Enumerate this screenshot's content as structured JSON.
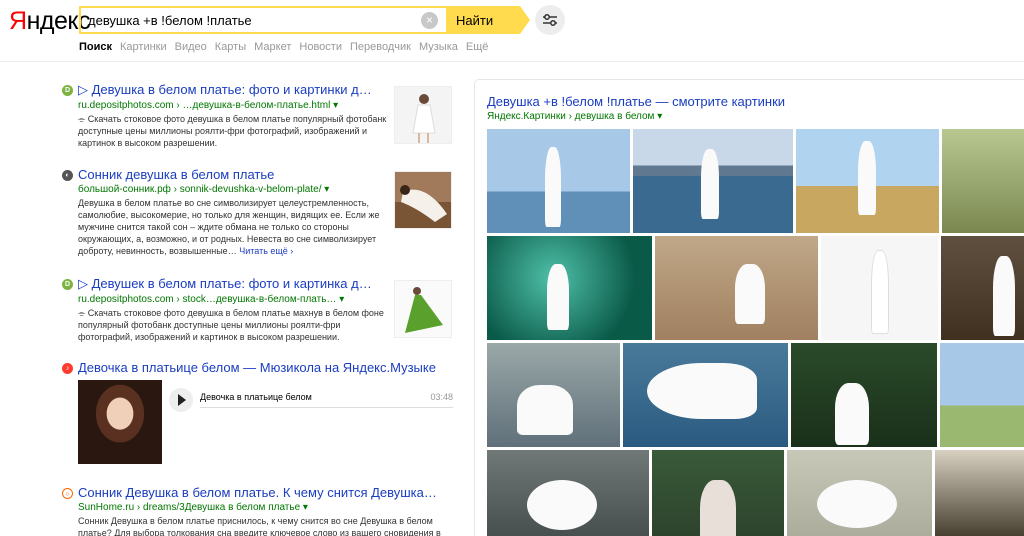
{
  "header": {
    "logo": "Яндекс",
    "query": "девушка +в !белом !платье",
    "find_label": "Найти"
  },
  "tabs": [
    "Поиск",
    "Картинки",
    "Видео",
    "Карты",
    "Маркет",
    "Новости",
    "Переводчик",
    "Музыка",
    "Ещё"
  ],
  "results": [
    {
      "title": "▷ Девушка в белом платье: фото и картинки д…",
      "url": "ru.depositphotos.com › …девушка-в-белом-платье.html ▾",
      "snippet": "⌯ Скачать стоковое фото девушка в белом платье популярный фотобанк доступные цены миллионы роялти-фри фотографий, изображений и картинок в высоком разрешении."
    },
    {
      "title": "Сонник девушка в белом платье",
      "url": "большой-сонник.рф › sonnik-devushka-v-belom-plate/ ▾",
      "snippet": "Девушка в белом платье во сне символизирует целеустремленность, самолюбие, высокомерие, но только для женщин, видящих ее. Если же мужчине снится такой сон – ждите обмана не только со стороны окружающих, а, возможно, и от родных. Невеста во сне символизирует доброту, невинность, возвышенные…",
      "more": "Читать ещё ›"
    },
    {
      "title": "▷ Девушек в белом платье: фото и картинка д…",
      "url": "ru.depositphotos.com › stock…девушка-в-белом-плать… ▾",
      "snippet": "⌯ Скачать стоковое фото девушка в белом платье махнув в белом фоне популярный фотобанк доступные цены миллионы роялти-фри фотографий, изображений и картинок в высоком разрешении."
    },
    {
      "title": "Девочка в платьице белом — Мюзикола на Яндекс.Музыке",
      "track": "Девочка в платьице белом",
      "duration": "03:48"
    },
    {
      "title": "Сонник Девушка в белом платье. К чему снится Девушка…",
      "url": "SunHome.ru › dreams/3Девушка в белом платье ▾",
      "snippet": "Сонник Девушка в белом платье приснилось, к чему снится во сне Девушка в белом платье? Для выбора толкования сна введите ключевое слово из вашего сновидения в"
    }
  ],
  "images_panel": {
    "title": "Девушка +в !белом !платье — смотрите картинки",
    "url": "Яндекс.Картинки › девушка в белом ▾"
  },
  "colors": {
    "accent": "#ffdb4d",
    "link": "#1a3dc1",
    "url": "#007700",
    "logo_red": "#ff0000"
  }
}
